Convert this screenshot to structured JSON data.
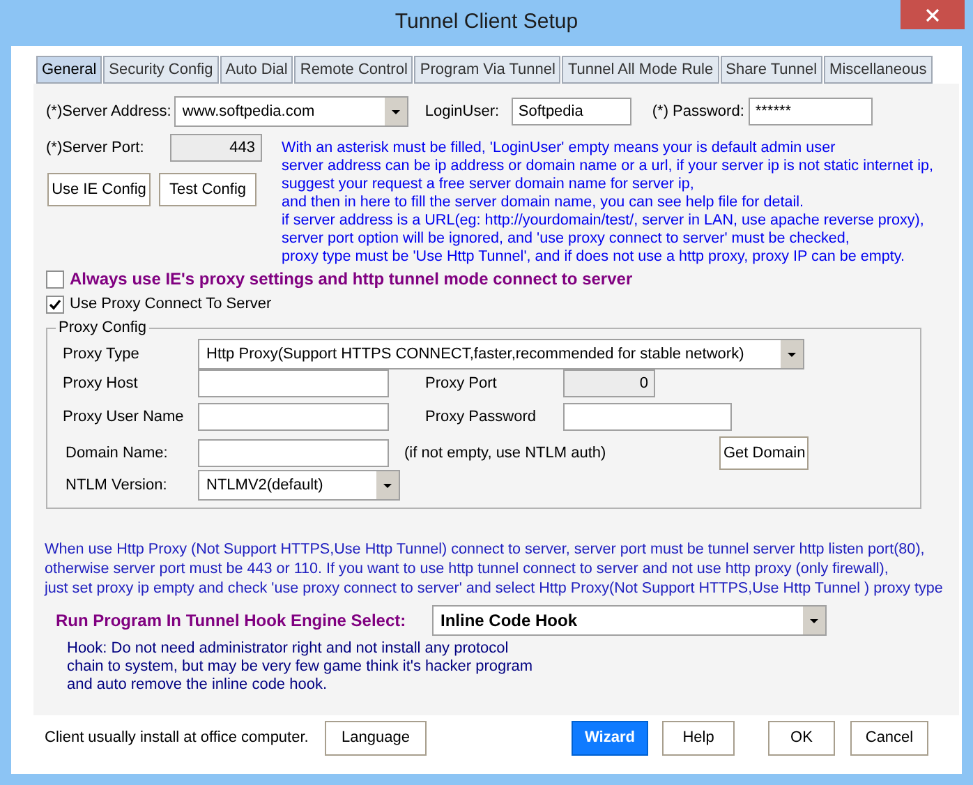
{
  "window": {
    "title": "Tunnel Client Setup"
  },
  "tabs": [
    {
      "label": "General",
      "selected": true
    },
    {
      "label": "Security Config",
      "selected": false
    },
    {
      "label": "Auto Dial",
      "selected": false
    },
    {
      "label": "Remote Control",
      "selected": false
    },
    {
      "label": "Program Via Tunnel",
      "selected": false
    },
    {
      "label": "Tunnel All Mode Rule",
      "selected": false
    },
    {
      "label": "Share Tunnel",
      "selected": false
    },
    {
      "label": "Miscellaneous",
      "selected": false
    }
  ],
  "general": {
    "server_address": {
      "label": "(*)Server Address:",
      "value": "www.softpedia.com"
    },
    "login_user": {
      "label": "LoginUser:",
      "value": "Softpedia"
    },
    "password": {
      "label": "(*) Password:",
      "value": "******"
    },
    "server_port": {
      "label": "(*)Server Port:",
      "value": "443"
    },
    "buttons": [
      "Use IE Config",
      "Test Config"
    ],
    "help_lines": [
      "With an asterisk must be filled, 'LoginUser' empty means your is default admin user",
      "server address can be ip address or domain name or a url, if your server ip is not static internet ip,",
      "suggest your request a free server domain name for server ip,",
      "and then in here to fill the server domain name, you can see help file for detail.",
      "if server address is a URL(eg: http://yourdomain/test/, server in LAN, use apache reverse proxy),",
      "server port option will be ignored, and 'use proxy connect to server' must be checked,",
      "proxy type must be 'Use Http Tunnel', and if does not use a http proxy, proxy IP can be empty."
    ],
    "checkboxes": [
      {
        "label": "Always use IE's proxy settings and http tunnel mode connect to server",
        "checked": false,
        "kind": "highlight"
      },
      {
        "label": "Use Proxy Connect To Server",
        "checked": true,
        "kind": "plain"
      }
    ],
    "proxy_config": {
      "title": "Proxy Config",
      "proxy_type": {
        "label": "Proxy Type",
        "value": "Http Proxy(Support HTTPS CONNECT,faster,recommended for stable network)"
      },
      "proxy_host": {
        "label": "Proxy Host"
      },
      "proxy_port": {
        "label": "Proxy Port",
        "value": "0"
      },
      "proxy_user_name": {
        "label": "Proxy User Name"
      },
      "proxy_password": {
        "label": "Proxy Password"
      },
      "domain_name": {
        "label": "Domain Name:",
        "note": "(if not empty, use NTLM auth)"
      },
      "get_domain_button": "Get Domain",
      "ntlm_version": {
        "label": "NTLM Version:",
        "value": "NTLMV2(default)"
      }
    },
    "note_lines": [
      "When use Http Proxy (Not Support HTTPS,Use Http Tunnel) connect to server, server port must be tunnel server http listen port(80),",
      "otherwise server port must be 443 or 110. If you want to use http tunnel connect to server and not use http proxy (only firewall),",
      "just set proxy ip empty and check  'use proxy connect to server' and select Http Proxy(Not Support HTTPS,Use Http Tunnel ) proxy type"
    ],
    "hook_engine": {
      "label": "Run Program In Tunnel Hook Engine Select:",
      "value": "Inline Code Hook"
    },
    "hook_description": [
      "Hook: Do not need administrator right and not install any protocol",
      "chain to system, but may be very few game think it's hacker program",
      "and auto remove the inline code hook."
    ]
  },
  "footer": {
    "note": "Client usually install at office computer.",
    "buttons": [
      {
        "label": "Language",
        "kind": "normal"
      },
      {
        "label": "Wizard",
        "kind": "primary"
      },
      {
        "label": "Help",
        "kind": "normal"
      },
      {
        "label": "OK",
        "kind": "normal"
      },
      {
        "label": "Cancel",
        "kind": "normal"
      }
    ]
  }
}
